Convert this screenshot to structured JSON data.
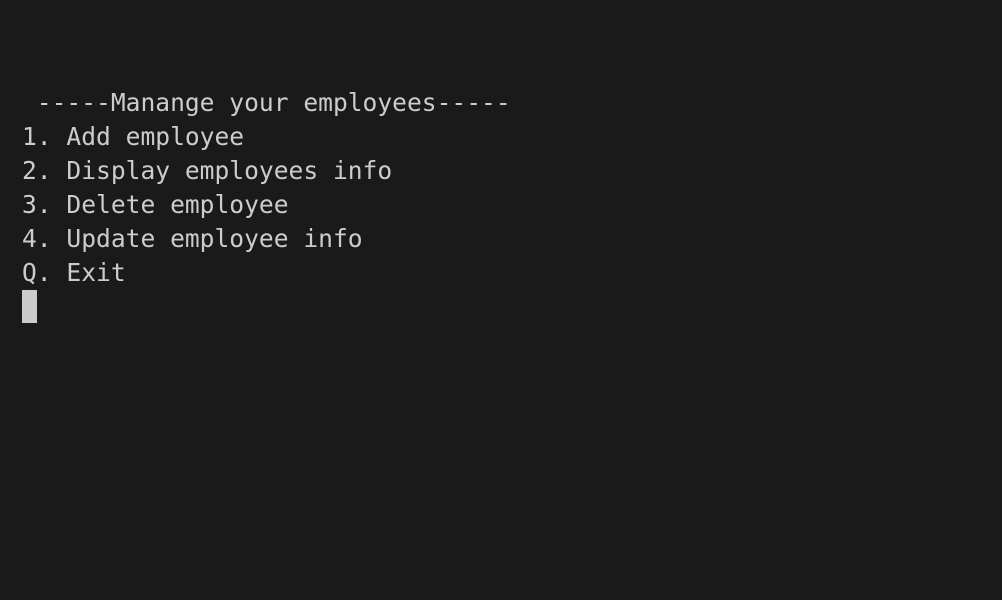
{
  "terminal": {
    "header": " -----Manange your employees-----",
    "menu": [
      "1. Add employee",
      "2. Display employees info",
      "3. Delete employee",
      "4. Update employee info",
      "Q. Exit"
    ]
  },
  "colors": {
    "background": "#1a1a1a",
    "text": "#cccccc",
    "cursor": "#cccccc"
  }
}
